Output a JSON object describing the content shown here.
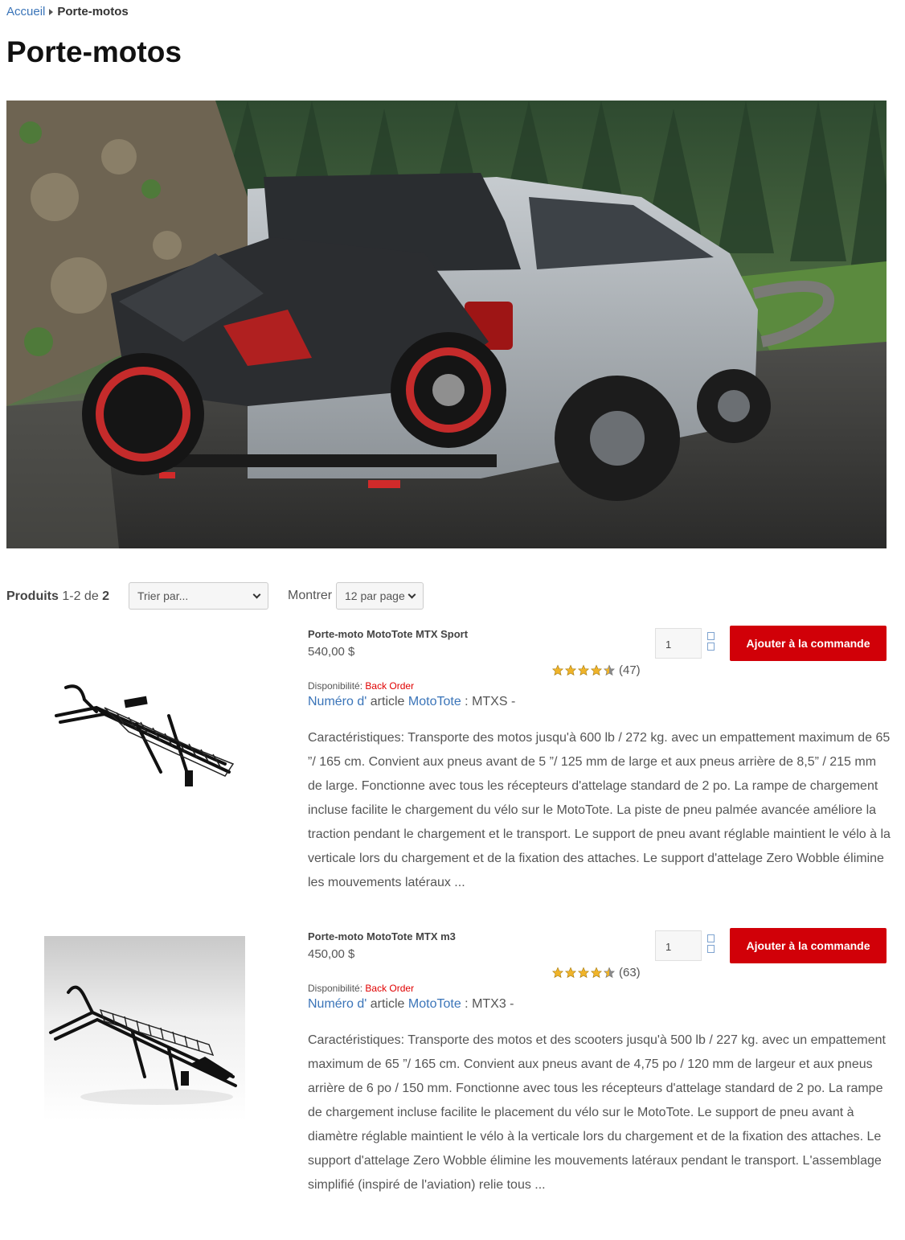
{
  "breadcrumb": {
    "home": "Accueil",
    "current": "Porte-motos"
  },
  "page_title": "Porte-motos",
  "toolbar": {
    "products_word": "Produits",
    "range": "1-2",
    "of_word": "de",
    "total": "2",
    "sort_value": "Trier par...",
    "show_label": "Montrer",
    "limit_value": "12 par page"
  },
  "products": [
    {
      "name": "Porte-moto MotoTote MTX Sport",
      "price": "540,00 $",
      "qty": "1",
      "add_label": "Ajouter à la commande",
      "rating": 4.5,
      "review_count": "(47)",
      "availability_label": "Disponibilité:",
      "availability_value": "Back Order",
      "sku_label_link": "Numéro d'",
      "sku_label_rest": "article",
      "brand": "MotoTote",
      "sku": ": MTXS -",
      "description": "Caractéristiques: Transporte des motos jusqu'à 600 lb / 272 kg. avec un empattement maximum de 65 ”/ 165 cm. Convient aux pneus avant de 5 ”/ 125 mm de large et aux pneus arrière de 8,5” / 215 mm de large. Fonctionne avec tous les récepteurs d'attelage standard de 2 po. La rampe de chargement incluse facilite le chargement du vélo sur le MotoTote. La piste de pneu palmée avancée améliore la traction pendant le chargement et le transport. Le support de pneu avant réglable maintient le vélo à la verticale lors du chargement et de la fixation des attaches. Le support d'attelage Zero Wobble élimine les mouvements latéraux ..."
    },
    {
      "name": "Porte-moto MotoTote MTX m3",
      "price": "450,00 $",
      "qty": "1",
      "add_label": "Ajouter à la commande",
      "rating": 4.5,
      "review_count": "(63)",
      "availability_label": "Disponibilité:",
      "availability_value": "Back Order",
      "sku_label_link": "Numéro d'",
      "sku_label_rest": "article",
      "brand": "MotoTote",
      "sku": ": MTX3 -",
      "description": "Caractéristiques: Transporte des motos et des scooters jusqu'à 500 lb / 227 kg. avec un empattement maximum de 65 ”/ 165 cm. Convient aux pneus avant de 4,75 po / 120 mm de largeur et aux pneus arrière de 6 po / 150 mm. Fonctionne avec tous les récepteurs d'attelage standard de 2 po. La rampe de chargement incluse facilite le placement du vélo sur le MotoTote. Le support de pneu avant à diamètre réglable maintient le vélo à la verticale lors du chargement et de la fixation des attaches. Le support d'attelage Zero Wobble élimine les mouvements latéraux pendant le transport. L'assemblage simplifié (inspiré de l'aviation) relie tous ..."
    }
  ],
  "colors": {
    "accent": "#d10008",
    "link": "#3a74b8",
    "backorder": "#e00000"
  },
  "icons": {
    "breadcrumb_sep": "caret-right-icon",
    "select": "chevron-down-icon",
    "rating": "star-icon"
  }
}
